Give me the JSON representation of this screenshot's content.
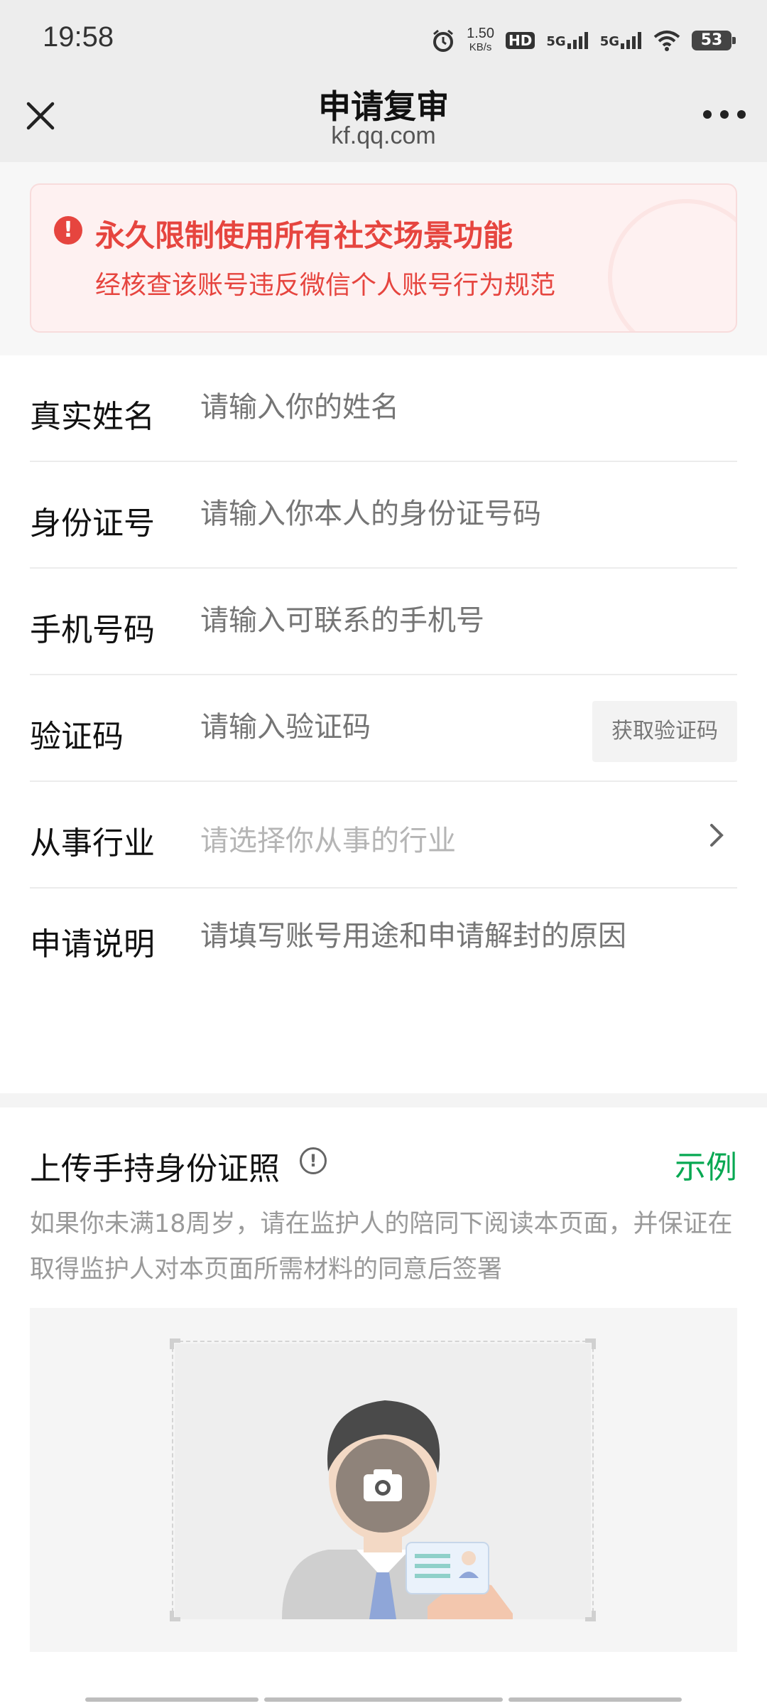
{
  "status_bar": {
    "time": "19:58",
    "net_speed_value": "1.50",
    "net_speed_unit": "KB/s",
    "hd": "HD",
    "sim1": "5G",
    "sim2": "5G",
    "battery": "53",
    "icons": [
      "alarm-icon",
      "hd-icon",
      "signal-icon",
      "signal-icon",
      "wifi-icon",
      "battery-icon"
    ]
  },
  "nav": {
    "title": "申请复审",
    "domain": "kf.qq.com",
    "close_icon": "close-icon",
    "more_icon": "more-icon"
  },
  "banner": {
    "title": "永久限制使用所有社交场景功能",
    "subtitle": "经核查该账号违反微信个人账号行为规范",
    "icon": "warning-icon",
    "color": "#e6453f"
  },
  "form": {
    "name": {
      "label": "真实姓名",
      "placeholder": "请输入你的姓名",
      "value": ""
    },
    "id_number": {
      "label": "身份证号",
      "placeholder": "请输入你本人的身份证号码",
      "value": ""
    },
    "phone": {
      "label": "手机号码",
      "placeholder": "请输入可联系的手机号",
      "value": ""
    },
    "code": {
      "label": "验证码",
      "placeholder": "请输入验证码",
      "value": "",
      "button": "获取验证码"
    },
    "industry": {
      "label": "从事行业",
      "placeholder": "请选择你从事的行业",
      "value": ""
    },
    "reason": {
      "label": "申请说明",
      "placeholder": "请填写账号用途和申请解封的原因",
      "value": ""
    }
  },
  "upload": {
    "title": "上传手持身份证照",
    "info_icon": "info-icon",
    "example_link": "示例",
    "description": "如果你未满18周岁，请在监护人的陪同下阅读本页面，并保证在取得监护人对本页面所需材料的同意后签署",
    "camera_icon": "camera-icon",
    "accent_color": "#07a852"
  }
}
